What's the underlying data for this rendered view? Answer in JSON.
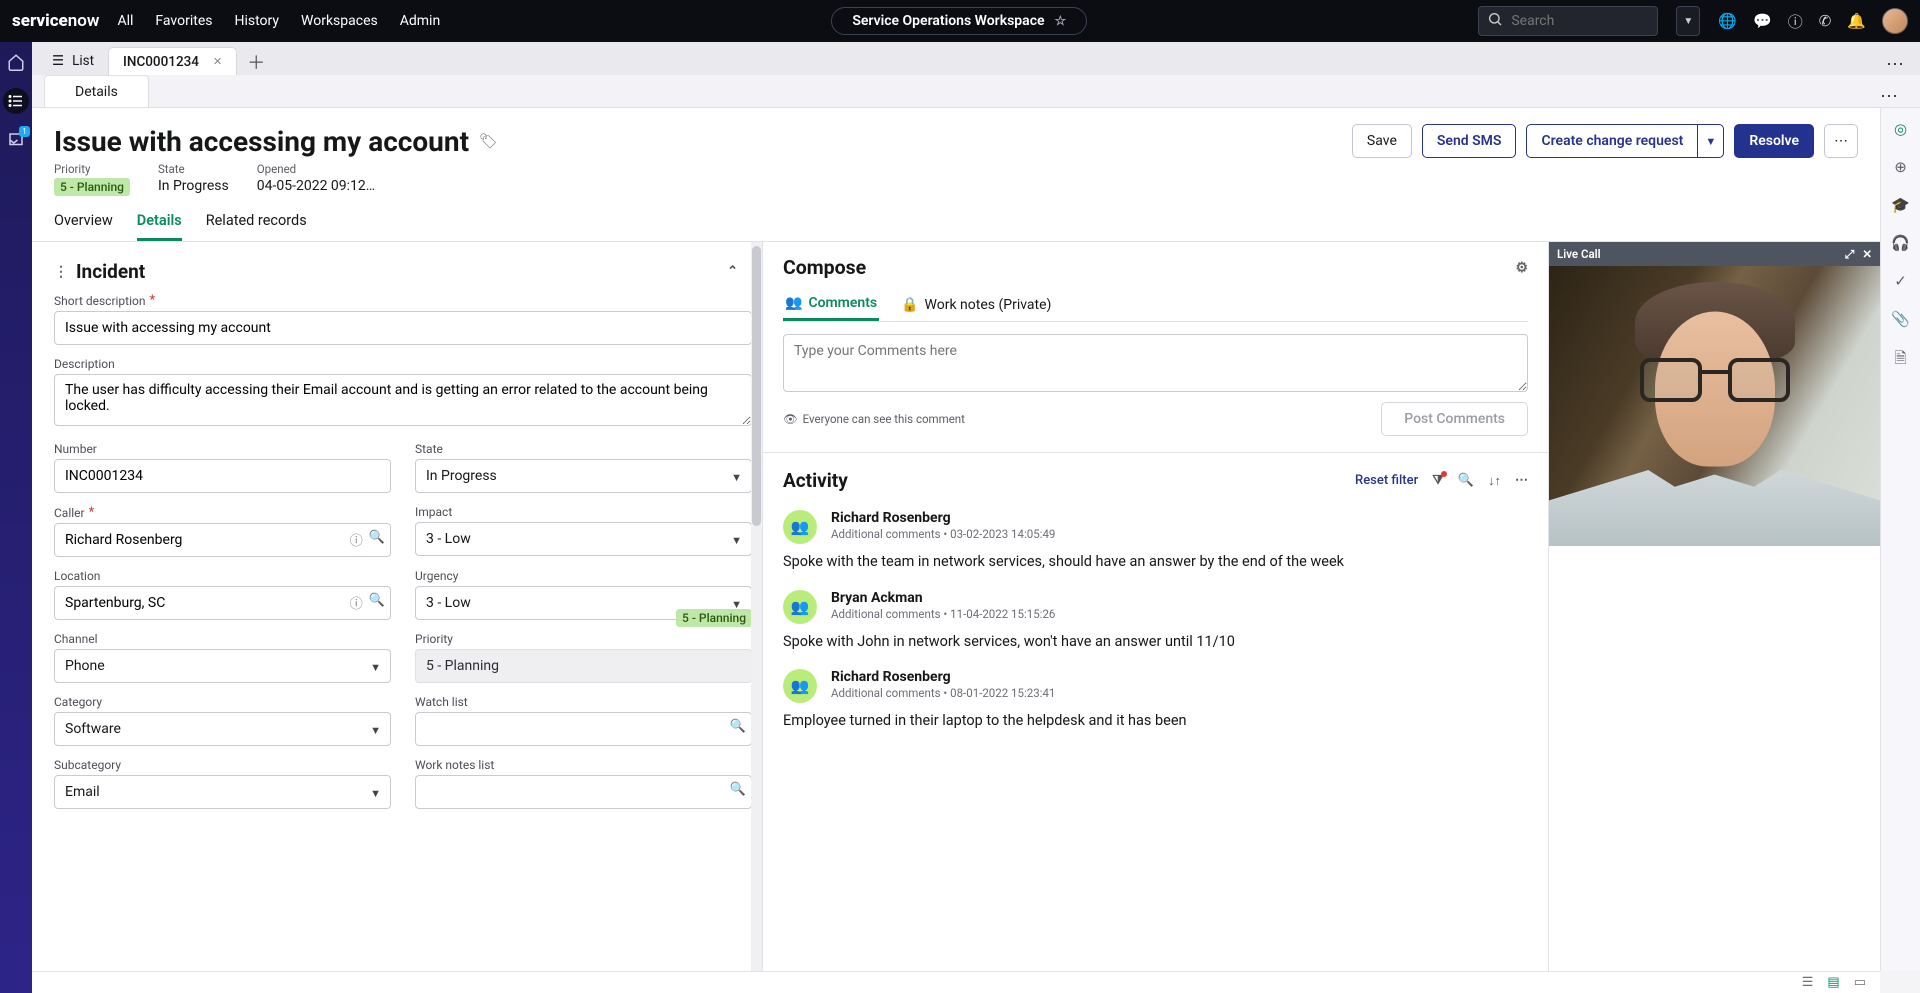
{
  "brand": "servicenow",
  "topnav": [
    "All",
    "Favorites",
    "History",
    "Workspaces",
    "Admin"
  ],
  "workspace_pill": "Service Operations Workspace",
  "search_placeholder": "Search",
  "tabs": {
    "list_label": "List",
    "active_label": "INC0001234"
  },
  "subtab": "Details",
  "title": "Issue with accessing my account",
  "actions": {
    "save": "Save",
    "send_sms": "Send SMS",
    "create_change": "Create change request",
    "resolve": "Resolve"
  },
  "meta": {
    "priority_lbl": "Priority",
    "priority_val": "5 - Planning",
    "state_lbl": "State",
    "state_val": "In Progress",
    "opened_lbl": "Opened",
    "opened_val": "04-05-2022 09:12…"
  },
  "rectabs": [
    "Overview",
    "Details",
    "Related records"
  ],
  "section_title": "Incident",
  "form": {
    "short_desc_lbl": "Short description",
    "short_desc_val": "Issue with accessing my account",
    "desc_lbl": "Description",
    "desc_val": "The user has difficulty accessing their Email account and is getting an error related to the account being locked.",
    "number_lbl": "Number",
    "number_val": "INC0001234",
    "state_lbl": "State",
    "state_val": "In Progress",
    "caller_lbl": "Caller",
    "caller_val": "Richard Rosenberg",
    "impact_lbl": "Impact",
    "impact_val": "3 - Low",
    "location_lbl": "Location",
    "location_val": "Spartenburg, SC",
    "urgency_lbl": "Urgency",
    "urgency_val": "3 - Low",
    "channel_lbl": "Channel",
    "channel_val": "Phone",
    "priority_lbl": "Priority",
    "priority_val": "5 - Planning",
    "priority_badge": "5 - Planning",
    "category_lbl": "Category",
    "category_val": "Software",
    "watch_lbl": "Watch list",
    "watch_val": "",
    "subcategory_lbl": "Subcategory",
    "subcategory_val": "Email",
    "worknotes_list_lbl": "Work notes list",
    "worknotes_list_val": ""
  },
  "compose": {
    "header": "Compose",
    "tab_comments": "Comments",
    "tab_worknotes": "Work notes (Private)",
    "placeholder": "Type your Comments here",
    "visibility": "Everyone can see this comment",
    "post": "Post Comments"
  },
  "activity": {
    "header": "Activity",
    "reset": "Reset filter",
    "entries": [
      {
        "name": "Richard Rosenberg",
        "sub": "Additional comments • 03-02-2023 14:05:49",
        "text": "Spoke with the team in network services, should have an answer by the end of the week"
      },
      {
        "name": "Bryan Ackman",
        "sub": "Additional comments • 11-04-2022 15:15:26",
        "text": "Spoke with John in network services, won't have an answer until 11/10"
      },
      {
        "name": "Richard Rosenberg",
        "sub": "Additional comments • 08-01-2022 15:23:41",
        "text": "Employee turned in their laptop to the helpdesk and it has been"
      }
    ]
  },
  "livecall": "Live Call"
}
